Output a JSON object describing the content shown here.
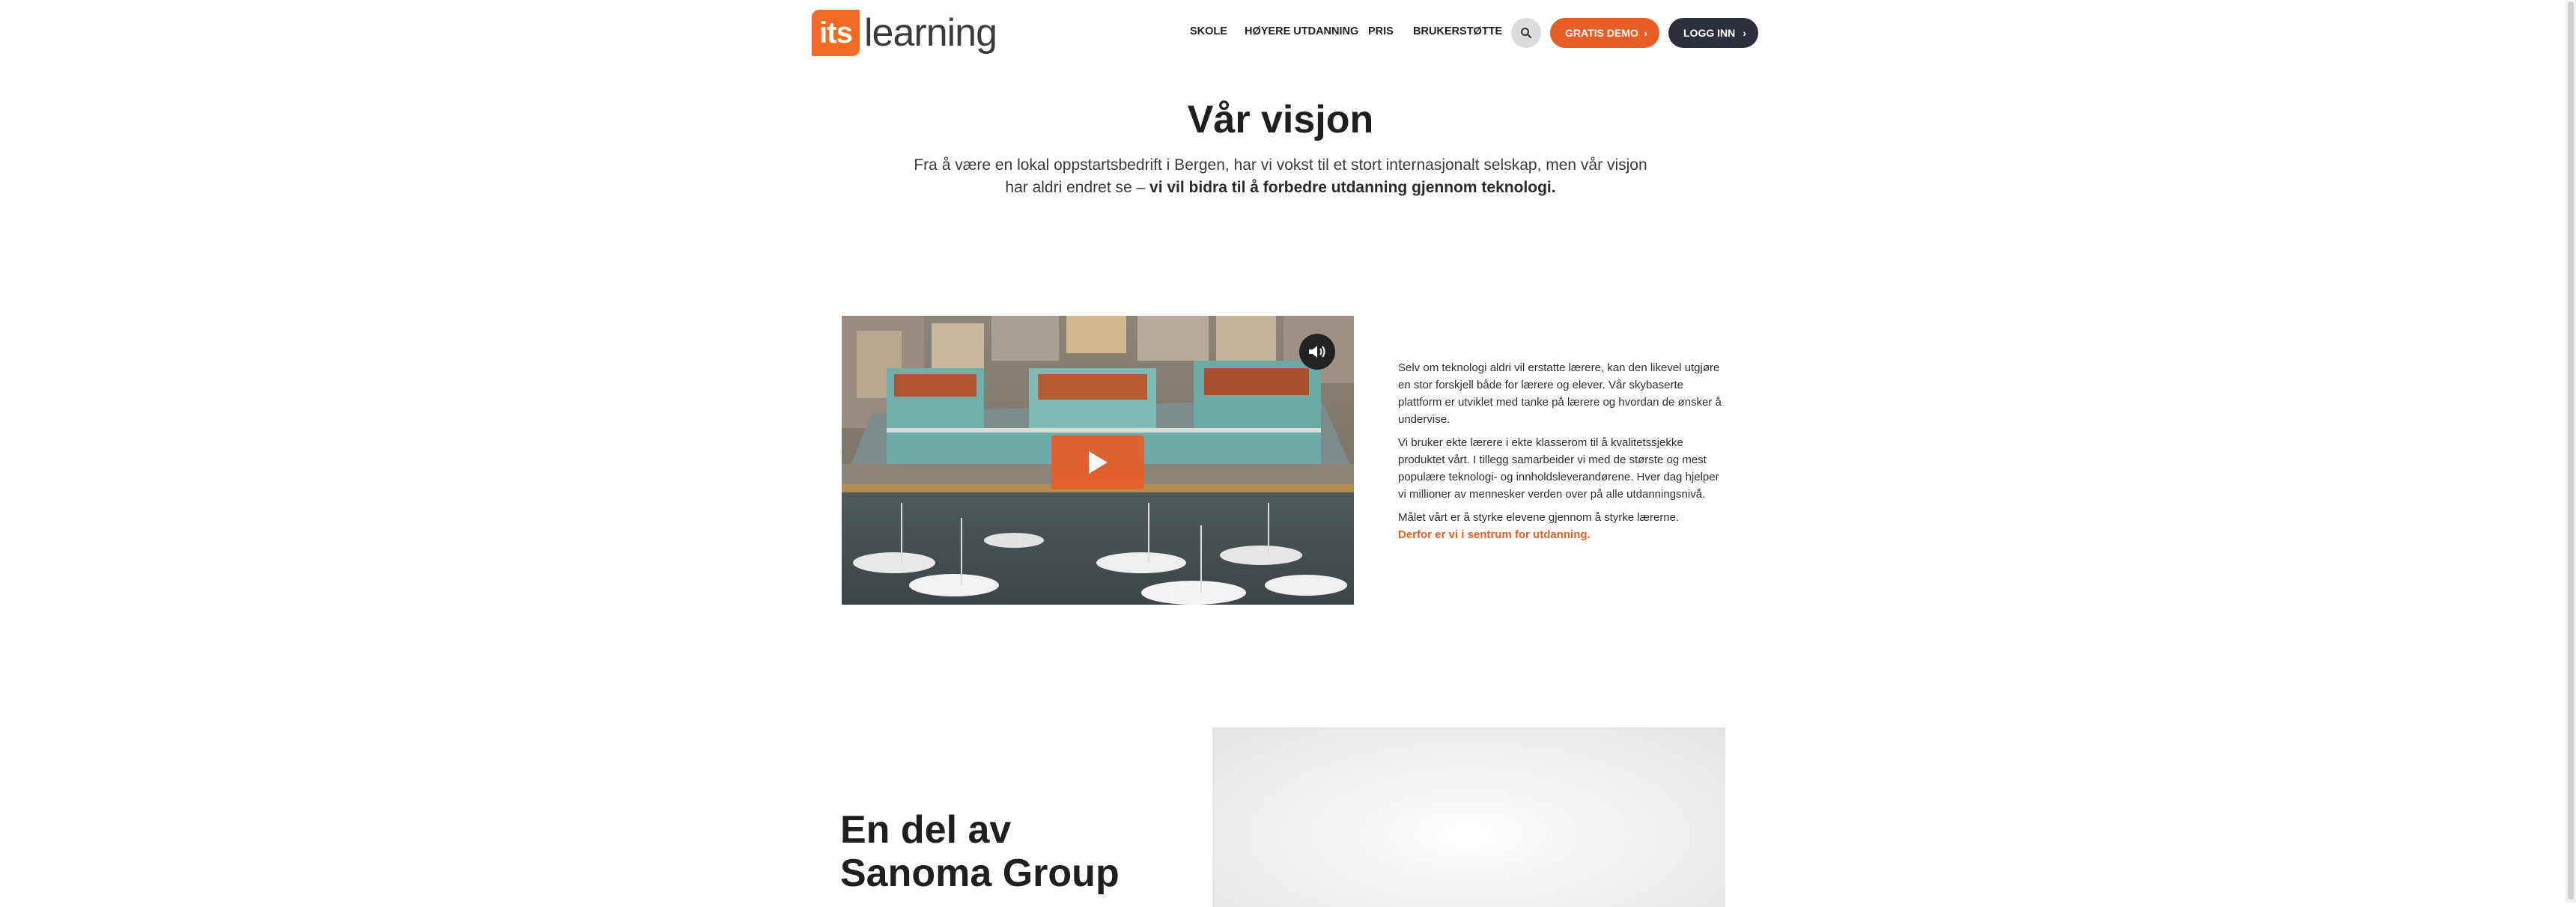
{
  "brand": {
    "logo_box": "its",
    "logo_word": "learning",
    "accent": "#e85d26",
    "dark": "#2d2f3a"
  },
  "nav": {
    "items": [
      "SKOLE",
      "HØYERE UTDANNING",
      "PRIS",
      "BRUKERSTØTTE"
    ],
    "search_icon": "search-icon",
    "demo_label": "GRATIS DEMO",
    "login_label": "LOGG INN"
  },
  "vision": {
    "title": "Vår visjon",
    "lead_plain": "Fra å være en lokal oppstartsbedrift i Bergen, har vi vokst til et stort internasjonalt selskap, men vår visjon har aldri endret se –",
    "lead_bold": "vi vil bidra til å forbedre utdanning gjennom teknologi."
  },
  "video": {
    "mute_icon": "volume-icon",
    "play_icon": "play-icon"
  },
  "about": {
    "p1": "Selv om teknologi aldri vil erstatte lærere, kan den likevel utgjøre en stor forskjell både for lærere og elever. Vår skybaserte plattform er utviklet med tanke på lærere og hvordan de ønsker å undervise.",
    "p2": "Vi bruker ekte lærere i ekte klasserom til å kvalitetssjekke produktet vårt. I tillegg samarbeider vi med de største og mest populære teknologi- og innholdsleverandørene. Hver dag hjelper vi millioner av mennesker verden over på alle utdanningsnivå.",
    "p3": "Målet vårt er å styrke elevene gjennom å styrke lærerne.",
    "p3_accent": "Derfor er vi i sentrum for utdanning."
  },
  "sanoma": {
    "heading": "En del av Sanoma Group"
  }
}
